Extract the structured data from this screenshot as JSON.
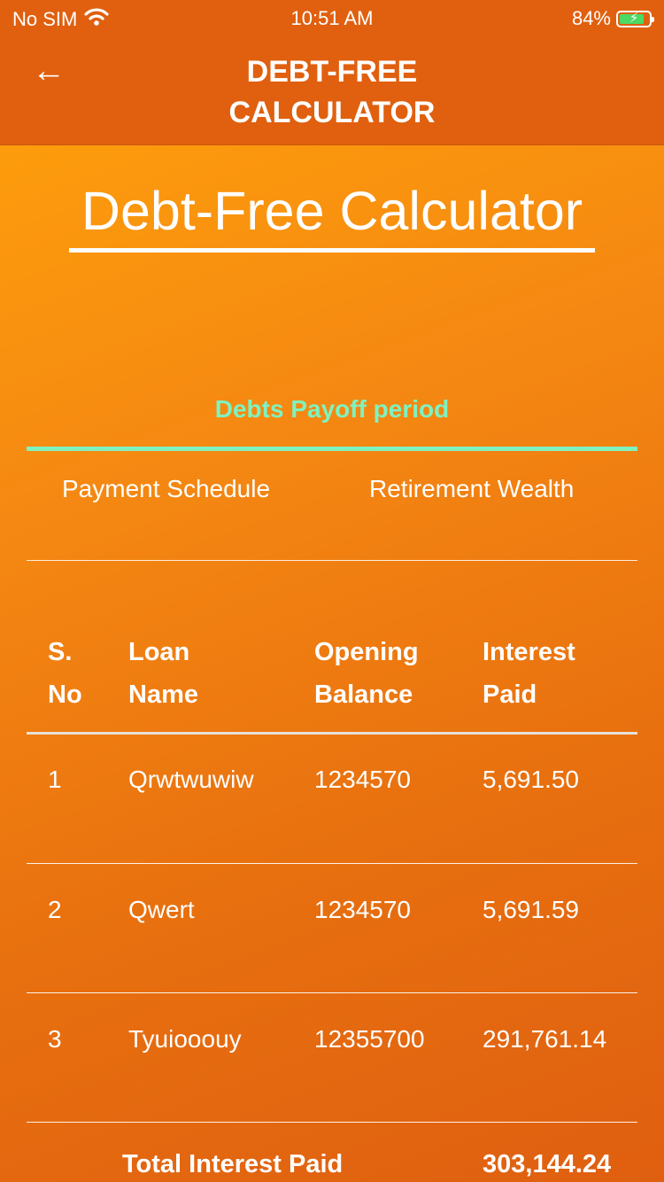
{
  "status_bar": {
    "carrier": "No SIM",
    "wifi_icon": "wifi-icon",
    "time": "10:51 AM",
    "battery_percent": "84%",
    "battery_level": 0.84,
    "battery_color": "#4cd964"
  },
  "nav": {
    "back_icon": "left-arrow-icon",
    "back_glyph": "←",
    "title_line1": "DEBT-FREE",
    "title_line2": "CALCULATOR",
    "bar_color": "#e0600f"
  },
  "hero": {
    "title": "Debt-Free Calculator"
  },
  "tabs": {
    "active": "Debts Payoff period",
    "payment_schedule": "Payment Schedule",
    "retirement_wealth": "Retirement Wealth",
    "active_color": "#7ff2c0"
  },
  "table": {
    "headers": {
      "sno_line1": "S.",
      "sno_line2": "No",
      "loan_line1": "Loan",
      "loan_line2": "Name",
      "opening_line1": "Opening",
      "opening_line2": "Balance",
      "interest_line1": "Interest",
      "interest_line2": "Paid"
    },
    "rows": [
      {
        "sno": "1",
        "loan_name": "Qrwtwuwiw",
        "opening_balance": "1234570",
        "interest_paid": "5,691.50"
      },
      {
        "sno": "2",
        "loan_name": "Qwert",
        "opening_balance": "1234570",
        "interest_paid": "5,691.59"
      },
      {
        "sno": "3",
        "loan_name": "Tyuiooouy",
        "opening_balance": "12355700",
        "interest_paid": "291,761.14"
      }
    ],
    "total_label": "Total Interest Paid",
    "total_value": "303,144.24"
  }
}
